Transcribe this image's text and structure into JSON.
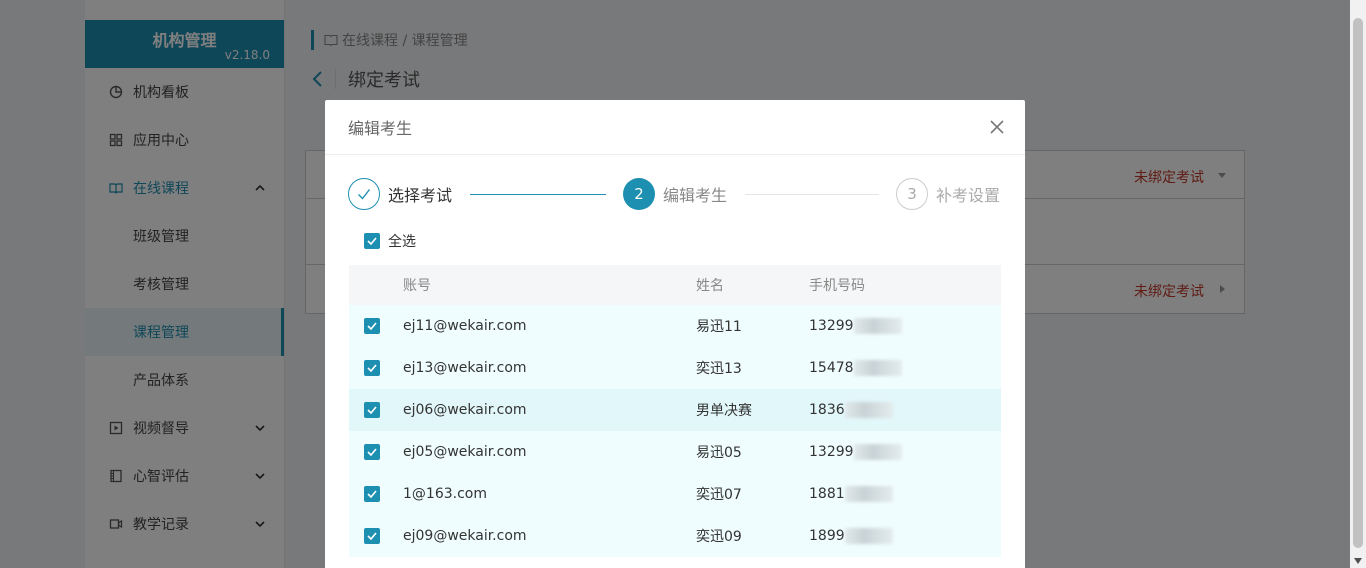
{
  "sidebar": {
    "brand_title": "机构管理",
    "brand_version": "v2.18.0",
    "items": [
      {
        "label": "机构看板",
        "icon": "pie-chart-icon"
      },
      {
        "label": "应用中心",
        "icon": "apps-icon"
      },
      {
        "label": "在线课程",
        "icon": "book-icon",
        "expanded": true
      },
      {
        "label": "班级管理"
      },
      {
        "label": "考核管理"
      },
      {
        "label": "课程管理",
        "active": true
      },
      {
        "label": "产品体系"
      },
      {
        "label": "视频督导",
        "icon": "play-icon"
      },
      {
        "label": "心智评估",
        "icon": "film-icon"
      },
      {
        "label": "教学记录",
        "icon": "video-icon"
      }
    ]
  },
  "breadcrumb": "在线课程 / 课程管理",
  "page_title": "绑定考试",
  "background": {
    "status_1": "未绑定考试",
    "status_2": "未绑定考试"
  },
  "modal": {
    "title": "编辑考生",
    "steps": [
      {
        "number": "1",
        "label": "选择考试",
        "state": "done"
      },
      {
        "number": "2",
        "label": "编辑考生",
        "state": "current"
      },
      {
        "number": "3",
        "label": "补考设置",
        "state": "pending"
      }
    ],
    "select_all_label": "全选",
    "columns": {
      "account": "账号",
      "name": "姓名",
      "phone": "手机号码"
    },
    "rows": [
      {
        "account": "ej11@wekair.com",
        "name": "易迅11",
        "phone_prefix": "13299"
      },
      {
        "account": "ej13@wekair.com",
        "name": "奕迅13",
        "phone_prefix": "15478"
      },
      {
        "account": "ej06@wekair.com",
        "name": "男单决赛",
        "phone_prefix": "1836"
      },
      {
        "account": "ej05@wekair.com",
        "name": "易迅05",
        "phone_prefix": "13299"
      },
      {
        "account": "1@163.com",
        "name": "奕迅07",
        "phone_prefix": "1881"
      },
      {
        "account": "ej09@wekair.com",
        "name": "奕迅09",
        "phone_prefix": "1899"
      }
    ]
  },
  "colors": {
    "accent": "#1d8fb0",
    "status_red": "#c0392b",
    "row_bg": "#f0fdfe",
    "row_highlight": "#e2f7fa"
  }
}
